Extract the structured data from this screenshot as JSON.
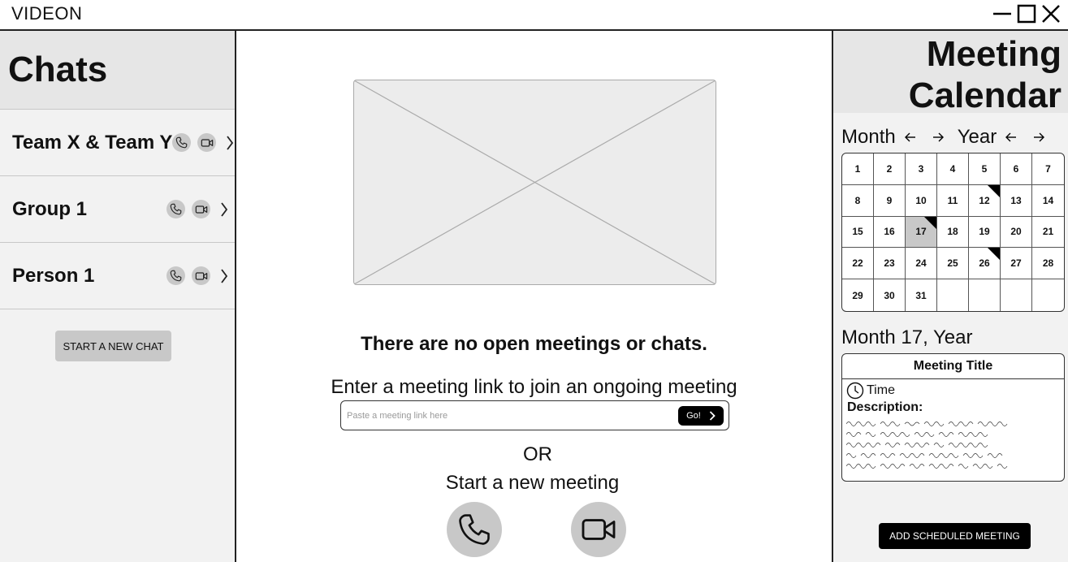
{
  "app": {
    "title": "VIDEON",
    "window_controls": [
      "minimize-icon",
      "maximize-icon",
      "close-icon"
    ]
  },
  "sidebar": {
    "title": "Chats",
    "chats": [
      {
        "name": "Team X & Team Y",
        "icons": [
          "phone-icon",
          "video-camera-icon",
          "chevron-right-icon"
        ]
      },
      {
        "name": "Group 1",
        "icons": [
          "phone-icon",
          "video-camera-icon",
          "chevron-right-icon"
        ]
      },
      {
        "name": "Person 1",
        "icons": [
          "phone-icon",
          "video-camera-icon",
          "chevron-right-icon"
        ]
      }
    ],
    "new_chat_label": "START A NEW CHAT"
  },
  "main": {
    "image_placeholder": "image-placeholder",
    "empty_message": "There are no open meetings or chats.",
    "join_label": "Enter a meeting link to join an ongoing meeting",
    "link_placeholder": "Paste a meeting link here",
    "go_label": "Go!",
    "or_label": "OR",
    "new_meeting_label": "Start a new meeting",
    "start_buttons": [
      "phone-icon",
      "video-camera-icon"
    ]
  },
  "calendar": {
    "title_line1": "Meeting",
    "title_line2": "Calendar",
    "month_label": "Month",
    "year_label": "Year",
    "days": [
      "1",
      "2",
      "3",
      "4",
      "5",
      "6",
      "7",
      "8",
      "9",
      "10",
      "11",
      "12",
      "13",
      "14",
      "15",
      "16",
      "17",
      "18",
      "19",
      "20",
      "21",
      "22",
      "23",
      "24",
      "25",
      "26",
      "27",
      "28",
      "29",
      "30",
      "31",
      "",
      "",
      "",
      ""
    ],
    "selected_day": "17",
    "event_days": [
      "12",
      "17",
      "26"
    ],
    "selected_date_label": "Month 17, Year",
    "meeting": {
      "title": "Meeting Title",
      "time_label": "Time",
      "description_label": "Description:"
    },
    "add_label": "ADD SCHEDULED MEETING",
    "colors": {
      "panel_bg": "#f2f2f2",
      "header_bg": "#e6e6e6",
      "selected_day": "#c8c8c8",
      "button_dark": "#000000"
    }
  }
}
